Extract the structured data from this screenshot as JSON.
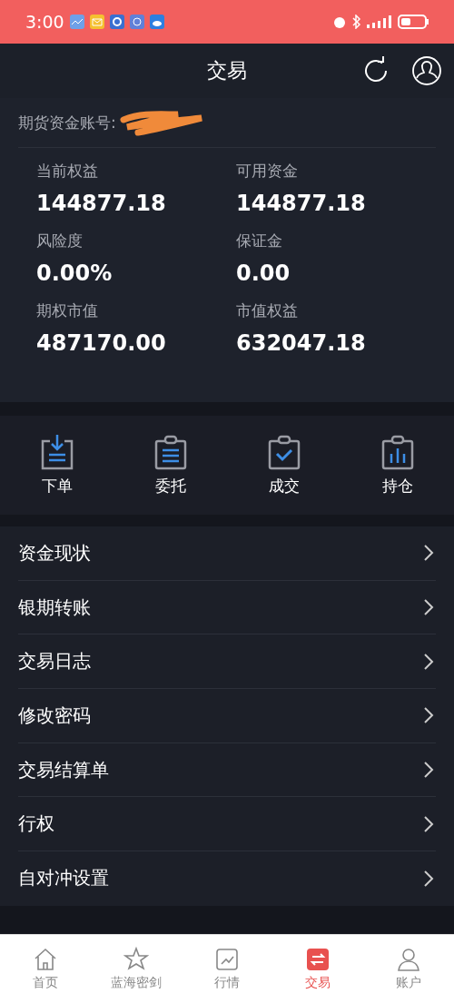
{
  "status_bar": {
    "time": "3:00"
  },
  "header": {
    "title": "交易"
  },
  "account": {
    "label": "期货资金账号:",
    "redacted": true
  },
  "metrics": [
    {
      "label": "当前权益",
      "value": "144877.18"
    },
    {
      "label": "可用资金",
      "value": "144877.18"
    },
    {
      "label": "风险度",
      "value": "0.00%"
    },
    {
      "label": "保证金",
      "value": "0.00"
    },
    {
      "label": "期权市值",
      "value": "487170.00"
    },
    {
      "label": "市值权益",
      "value": "632047.18"
    }
  ],
  "shortcuts": [
    {
      "label": "下单",
      "kind": "download"
    },
    {
      "label": "委托",
      "kind": "list"
    },
    {
      "label": "成交",
      "kind": "check"
    },
    {
      "label": "持仓",
      "kind": "bars"
    }
  ],
  "menu": [
    {
      "label": "资金现状"
    },
    {
      "label": "银期转账"
    },
    {
      "label": "交易日志"
    },
    {
      "label": "修改密码"
    },
    {
      "label": "交易结算单"
    },
    {
      "label": "行权"
    },
    {
      "label": "自对冲设置"
    }
  ],
  "tabs": [
    {
      "label": "首页",
      "kind": "home",
      "selected": false
    },
    {
      "label": "蓝海密剑",
      "kind": "star",
      "selected": false
    },
    {
      "label": "行情",
      "kind": "chart",
      "selected": false
    },
    {
      "label": "交易",
      "kind": "trade",
      "selected": true
    },
    {
      "label": "账户",
      "kind": "person",
      "selected": false
    }
  ]
}
